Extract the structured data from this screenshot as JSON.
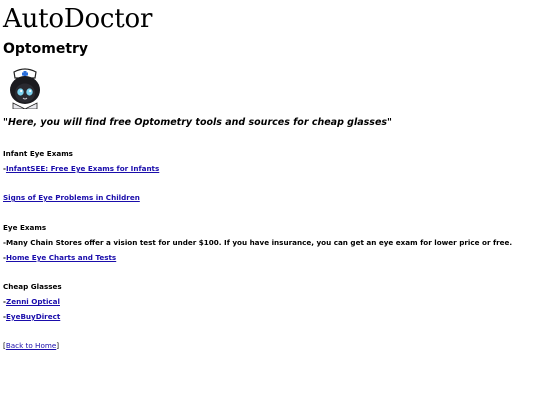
{
  "site": {
    "logo": "AutoDoctor",
    "page_title": "Optometry",
    "tagline": "\"Here, you will find free Optometry tools and sources for cheap glasses\""
  },
  "sections": {
    "infant": {
      "heading": "Infant Eye Exams",
      "prefix": "-",
      "link": "InfantSEE: Free Eye Exams for Infants"
    },
    "children": {
      "link": "Signs of Eye Problems in Children"
    },
    "exams": {
      "heading": "Eye Exams",
      "note": "-Many Chain Stores offer a vision test for under $100. If you have insurance, you can get an eye exam for lower price or free.",
      "prefix": "-",
      "link": "Home Eye Charts and Tests"
    },
    "glasses": {
      "heading": "Cheap Glasses",
      "prefix": "-",
      "link1": "Zenni Optical",
      "link2": "EyeBuyDirect"
    }
  },
  "footer": {
    "open_bracket": "[",
    "back_link": "Back to Home",
    "close_bracket": "]"
  },
  "mascot": {
    "icon": "nurse-mascot-icon"
  }
}
